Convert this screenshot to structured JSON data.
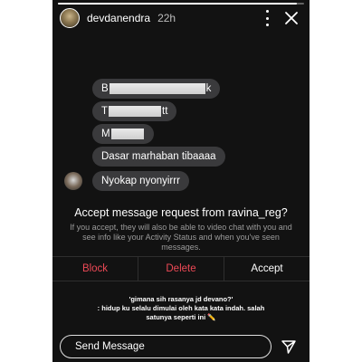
{
  "story": {
    "progress": 0.97,
    "username": "devdanendra",
    "time": "22h"
  },
  "messages": [
    {
      "visible_start": "B",
      "visible_end": "k"
    },
    {
      "visible_start": "T",
      "visible_end": "tt"
    },
    {
      "visible_start": "M",
      "visible_end": ""
    },
    {
      "text": "Dasar marhaban tibaaaa"
    },
    {
      "text": "Nyokap nyonyirrr"
    }
  ],
  "request": {
    "title": "Accept message request from ravina_reg?",
    "description": "If you accept, they will also be able to video chat with you and see info like your Activity Status and when you've seen messages."
  },
  "actions": {
    "block": "Block",
    "delete": "Delete",
    "accept": "Accept"
  },
  "caption": {
    "line1": "'gimana sih rasanya jd devano?'",
    "line2": ": hidup ku selalu dimulai oleh kata kata indah. salah",
    "line3": "satunya seperti ini ✏️"
  },
  "composer": {
    "placeholder": "Send Message"
  },
  "colors": {
    "background": "#121212",
    "bubble": "#3a3a3c",
    "destructive": "#ed4956"
  }
}
